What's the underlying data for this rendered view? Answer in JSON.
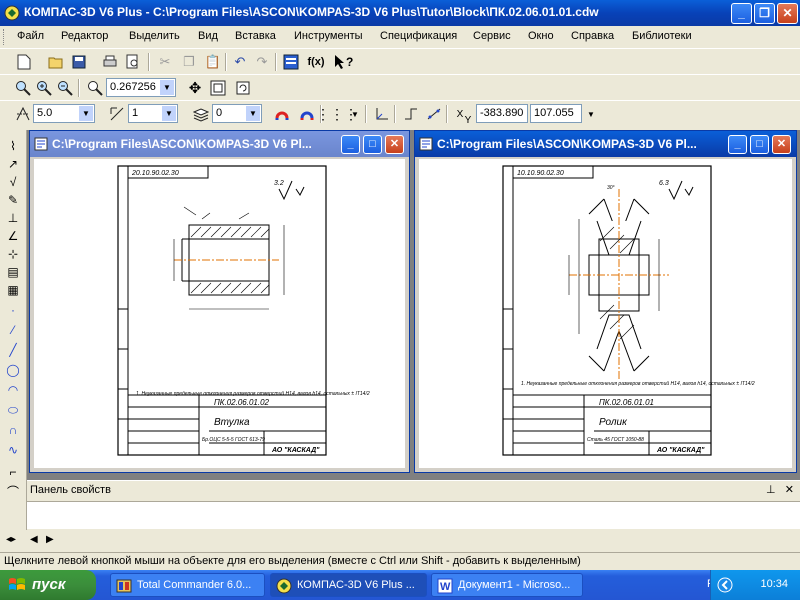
{
  "window": {
    "title": "КОМПАС-3D V6 Plus - C:\\Program Files\\ASCON\\KOMPAS-3D V6 Plus\\Tutor\\Block\\ПК.02.06.01.01.cdw",
    "min_label": "_",
    "max_label": "❐",
    "close_label": "✕"
  },
  "menu": {
    "items": [
      "Файл",
      "Редактор",
      "Выделить",
      "Вид",
      "Вставка",
      "Инструменты",
      "Спецификация",
      "Сервис",
      "Окно",
      "Справка",
      "Библиотеки"
    ]
  },
  "toolbar_view": {
    "zoom_value": "0.267256"
  },
  "toolbar_props": {
    "style_value": "5.0",
    "line_value": "1",
    "layer_value": "0",
    "x_label": "X",
    "y_label": "Y",
    "x_value": "-383.890",
    "y_value": "107.055"
  },
  "documents": [
    {
      "title": "C:\\Program Files\\ASCON\\KOMPAS-3D V6 Pl...",
      "code": "ПК.02.06.01.02",
      "stamp_code": "20.10.90.02.30",
      "name": "Втулка",
      "company": "АО \"КАСКАД\"",
      "material": "Бр.ОЦС 5-5-5 ГОСТ 613-79",
      "note": "1. Неуказанные предельные отклонения размеров отверстий H14, валов h14, остальных ± IT14/2",
      "roughness": "3.2"
    },
    {
      "title": "C:\\Program Files\\ASCON\\KOMPAS-3D V6 Pl...",
      "code": "ПК.02.06.01.01",
      "stamp_code": "10.10.90.02.30",
      "name": "Ролик",
      "company": "АО \"КАСКАД\"",
      "material": "Сталь 45 ГОСТ 1050-88",
      "note": "1. Неуказанные предельные отклонения размеров отверстий H14, валов h14, остальных ± IT14/2",
      "roughness": "6.3"
    }
  ],
  "props_panel": {
    "title": "Панель свойств",
    "pin": "⊥",
    "close": "✕"
  },
  "status": {
    "text": "Щелкните левой кнопкой мыши на объекте для его выделения (вместе с Ctrl или Shift - добавить к выделенным)"
  },
  "taskbar": {
    "start_label": "пуск",
    "tasks": [
      {
        "label": "Total Commander 6.0..."
      },
      {
        "label": "КОМПАС-3D V6 Plus ..."
      },
      {
        "label": "Документ1 - Microso..."
      }
    ],
    "language": "RU",
    "clock": "10:34"
  },
  "colors": {
    "titlebar": "#0a5fd8",
    "taskbar": "#245edb",
    "start": "#3b8e3b",
    "drawing_center": "#e07000"
  }
}
